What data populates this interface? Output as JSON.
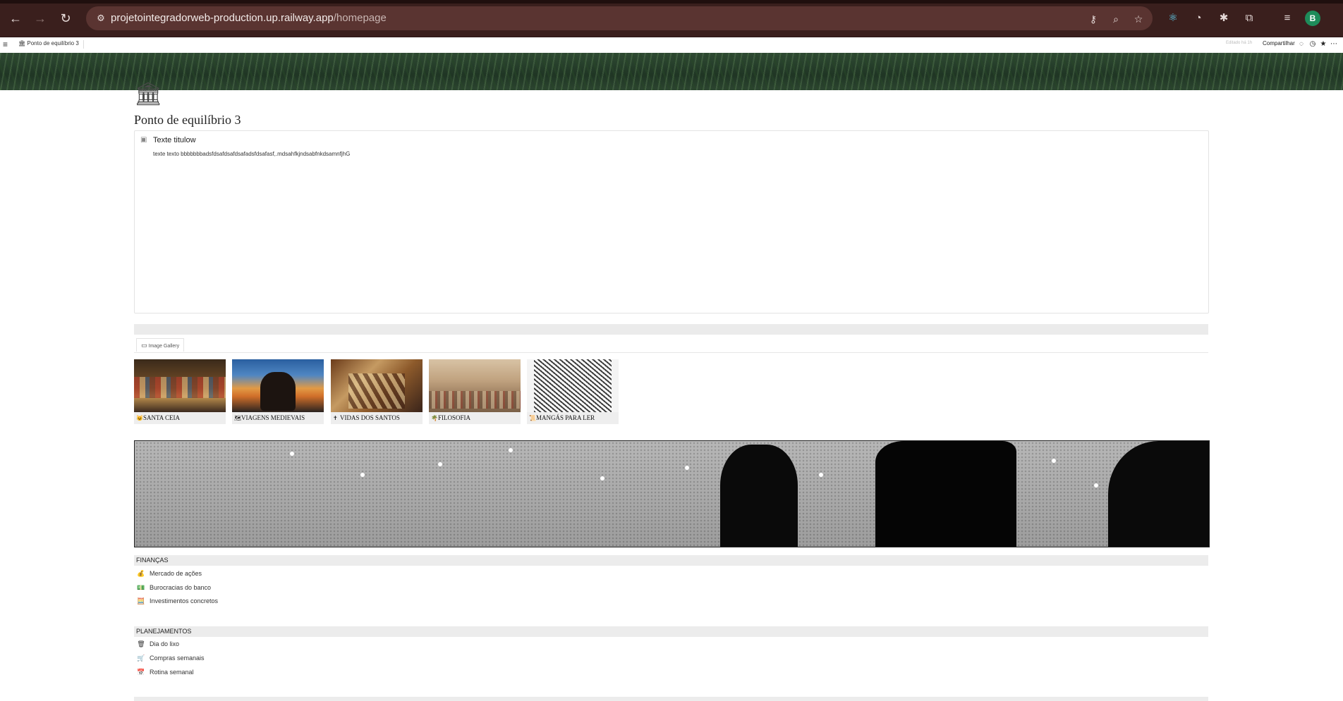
{
  "browser": {
    "url_host": "projetointegradorweb-production.up.railway.app",
    "url_path": "/homepage",
    "profile_initial": "B",
    "icons": [
      "back-icon",
      "forward-icon",
      "reload-icon",
      "site-settings-icon",
      "password-key-icon",
      "zoom-icon",
      "bookmark-star-icon",
      "react-devtools-icon",
      "clock-extension-icon",
      "gear-extension-icon",
      "extensions-puzzle-icon",
      "reading-list-icon"
    ]
  },
  "topbar": {
    "breadcrumb": "Ponto de equilíbrio 3",
    "edited": "Editado há 1h",
    "share_label": "Compartilhar"
  },
  "page": {
    "icon": "classical-building-icon",
    "title": "Ponto de equilíbrio 3"
  },
  "callout": {
    "title": "Texte titulow",
    "text": "texte texto bbbbbbbadsfdsafdsafdsafadsfdsafasf,.mdsahfkjndsabfnkdsamnfjhG"
  },
  "gallery": {
    "tab_label": "Image Gallery",
    "cards": [
      {
        "icon": "😺",
        "title": "SANTA CEIA"
      },
      {
        "icon": "🗺",
        "title": "VIAGENS MEDIEVAIS"
      },
      {
        "icon": "✝",
        "title": "VIDAS DOS SANTOS"
      },
      {
        "icon": "🌴",
        "title": "FILOSOFIA"
      },
      {
        "icon": "📜",
        "title": "MANGÁS PARA LER"
      }
    ]
  },
  "financas": {
    "heading": "FINANÇAS",
    "items": [
      {
        "icon": "💰",
        "label": "Mercado de ações"
      },
      {
        "icon": "💵",
        "label": "Burocracias do banco"
      },
      {
        "icon": "🧮",
        "label": "Investimentos concretos"
      }
    ]
  },
  "planejamentos": {
    "heading": "PLANEJAMENTOS",
    "items": [
      {
        "icon": "🗑",
        "label": "Dia do lixo"
      },
      {
        "icon": "🛒",
        "label": "Compras semanais"
      },
      {
        "icon": "📅",
        "label": "Rotina semanal"
      }
    ]
  }
}
